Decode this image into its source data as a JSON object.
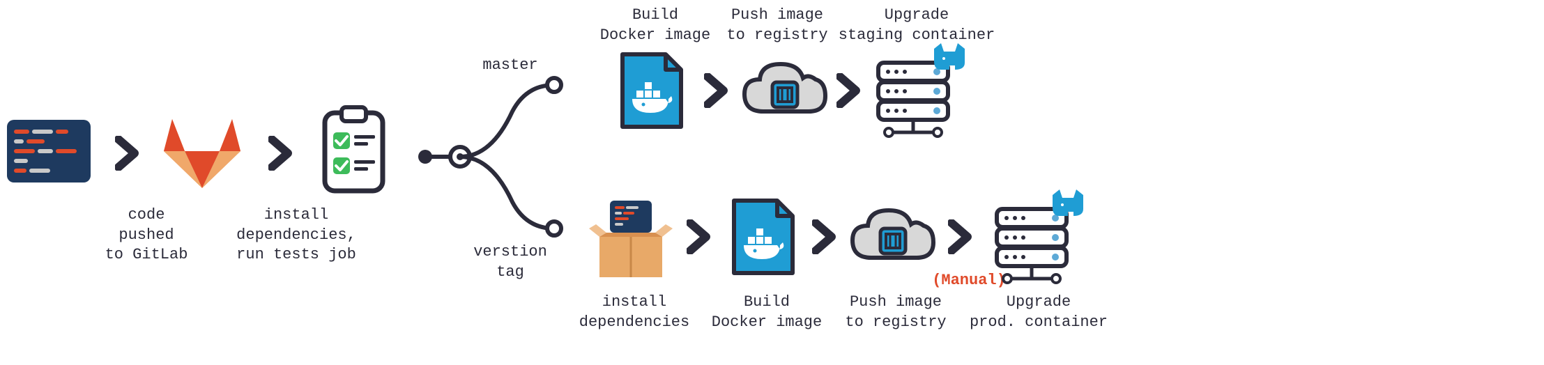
{
  "labels": {
    "code_pushed": "code\npushed\nto GitLab",
    "install_deps_tests": "install\ndependencies,\nrun tests job",
    "master": "master",
    "version_tag": "verstion\ntag",
    "build_docker_top": "Build\nDocker image",
    "push_registry_top": "Push image\nto registry",
    "upgrade_staging": "Upgrade\nstaging container",
    "install_deps_bottom": "install\ndependencies",
    "build_docker_bottom": "Build\nDocker image",
    "push_registry_bottom": "Push image\nto registry",
    "upgrade_prod": "Upgrade\nprod. container",
    "manual": "(Manual)"
  },
  "colors": {
    "dark": "#2b2b3a",
    "navy": "#1e3a5f",
    "orange": "#e8894a",
    "red": "#e04a2a",
    "blue": "#1f9dd4",
    "green": "#3dbb5a",
    "gray": "#c9c9c9",
    "lightblue": "#5da9d6"
  }
}
